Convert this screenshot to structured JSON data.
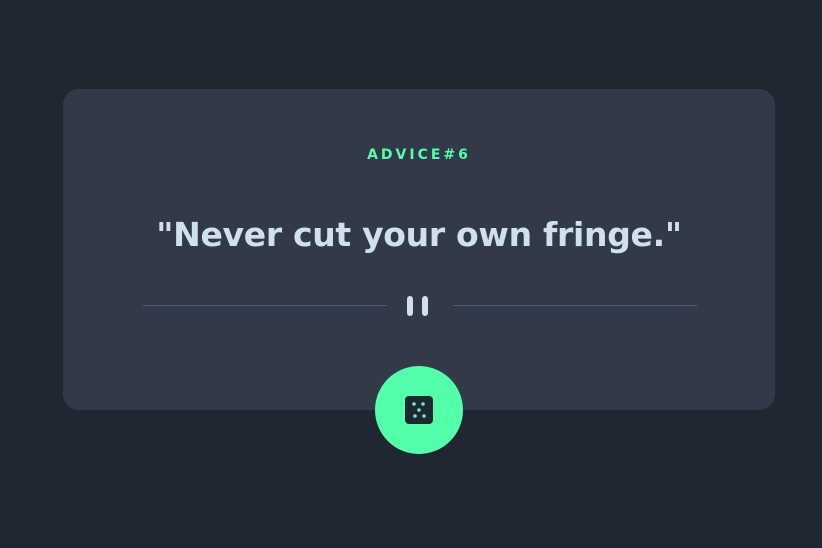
{
  "advice": {
    "label": "ADVICE#6",
    "text": "\"Never cut your own fringe.\""
  },
  "icons": {
    "divider": "pause-icon",
    "generate": "dice-icon"
  },
  "colors": {
    "background": "#202632",
    "card": "#323a49",
    "accent": "#53ffaa",
    "text": "#cee3e9",
    "divider": "#4f5d74"
  }
}
